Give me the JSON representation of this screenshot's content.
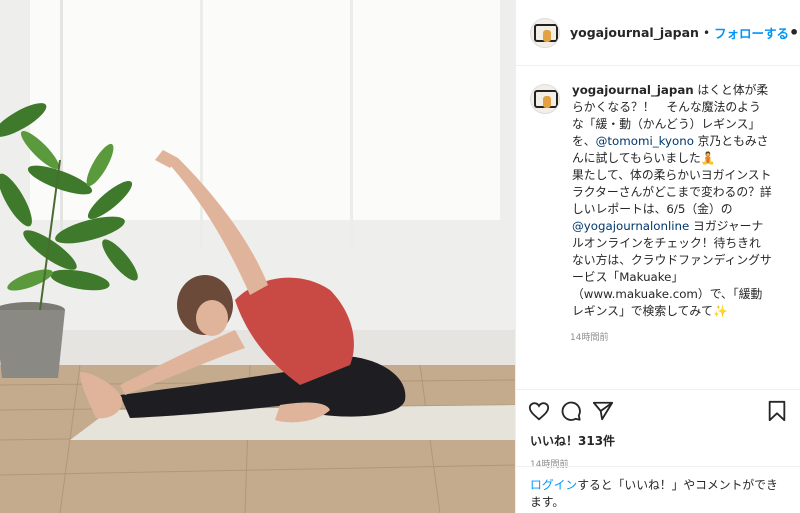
{
  "header": {
    "username": "yogajournal_japan",
    "separator": "•",
    "follow_label": "フォローする",
    "more_label": "•••"
  },
  "caption": {
    "username": "yogajournal_japan",
    "text_1": " はくと体が柔らかくなる？！　そんな魔法のような「緩・動（かんどう）レギンス」を、",
    "mention_1": "@tomomi_kyono",
    "text_2": " 京乃ともみさんに試してもらいました",
    "emoji_1": "🧘",
    "text_3": "果たして、体の柔らかいヨガインストラクターさんがどこまで変わるの？詳しいレポートは、6/5（金）の",
    "mention_2": "@yogajournalonline",
    "text_4": " ヨガジャーナルオンラインをチェック！待ちきれない方は、クラウドファンディングサービス「Makuake」（www.makuake.com）で、「緩動レギンス」で検索してみて",
    "emoji_2": "✨",
    "time": "14時間前"
  },
  "actions": {
    "icons": [
      "heart-icon",
      "comment-icon",
      "share-icon",
      "bookmark-icon"
    ]
  },
  "likes": "いいね！313件",
  "posted_time": "14時間前",
  "login": {
    "link": "ログイン",
    "text": "すると「いいね！」やコメントができます。"
  },
  "colors": {
    "link": "#0095f6",
    "mention": "#00376b",
    "muted": "#8e8e8e",
    "shirt": "#c94a45"
  }
}
